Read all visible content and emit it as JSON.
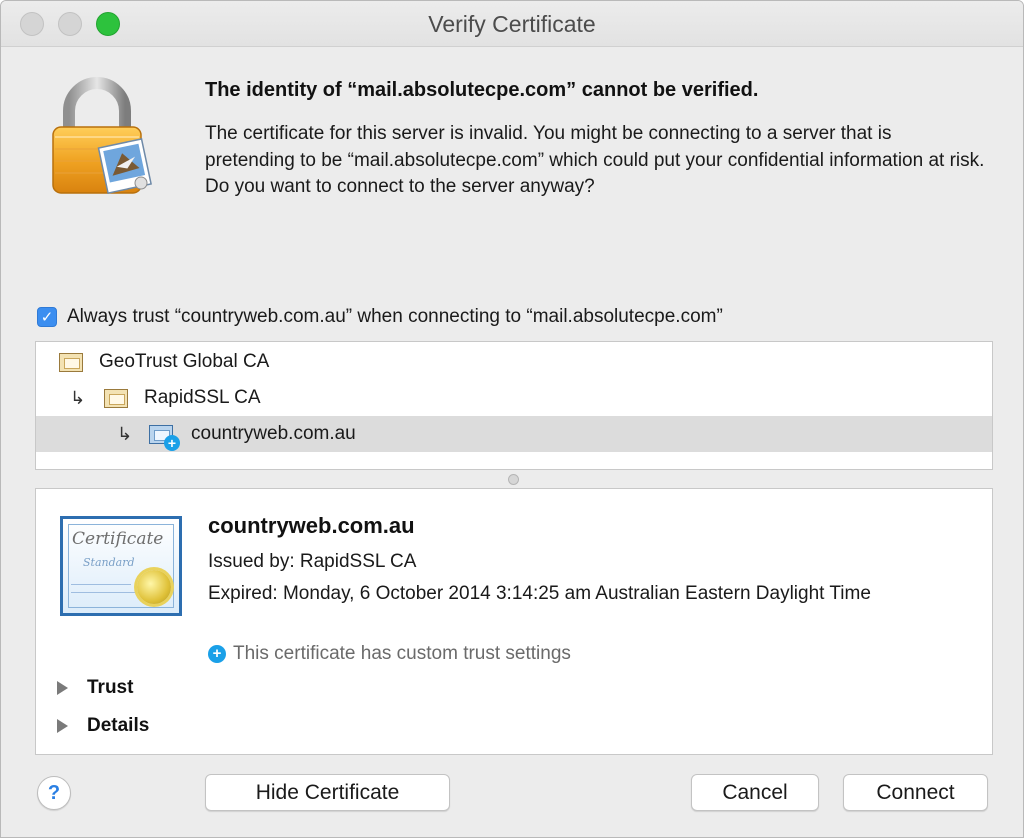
{
  "window": {
    "title": "Verify Certificate"
  },
  "message": {
    "headline": "The identity of “mail.absolutecpe.com” cannot be verified.",
    "body": "The certificate for this server is invalid. You might be connecting to a server that is pretending to be “mail.absolutecpe.com” which could put your confidential information at risk. Do you want to connect to the server anyway?"
  },
  "always_trust": {
    "checked": true,
    "label": "Always trust “countryweb.com.au” when connecting to “mail.absolutecpe.com”"
  },
  "chain": [
    {
      "label": "GeoTrust Global CA",
      "icon": "root-certificate-icon",
      "selected": false
    },
    {
      "label": "RapidSSL CA",
      "icon": "intermediate-certificate-icon",
      "selected": false
    },
    {
      "label": "countryweb.com.au",
      "icon": "certificate-custom-trust-icon",
      "selected": true
    }
  ],
  "details": {
    "cert_image": {
      "title": "Certificate",
      "subtitle": "Standard"
    },
    "name": "countryweb.com.au",
    "issued_by": "Issued by: RapidSSL CA",
    "expired": "Expired: Monday, 6 October 2014 3:14:25 am Australian Eastern Daylight Time",
    "custom_trust": "This certificate has custom trust settings",
    "sections": [
      "Trust",
      "Details"
    ]
  },
  "buttons": {
    "help": "?",
    "hide_certificate": "Hide Certificate",
    "cancel": "Cancel",
    "connect": "Connect"
  }
}
